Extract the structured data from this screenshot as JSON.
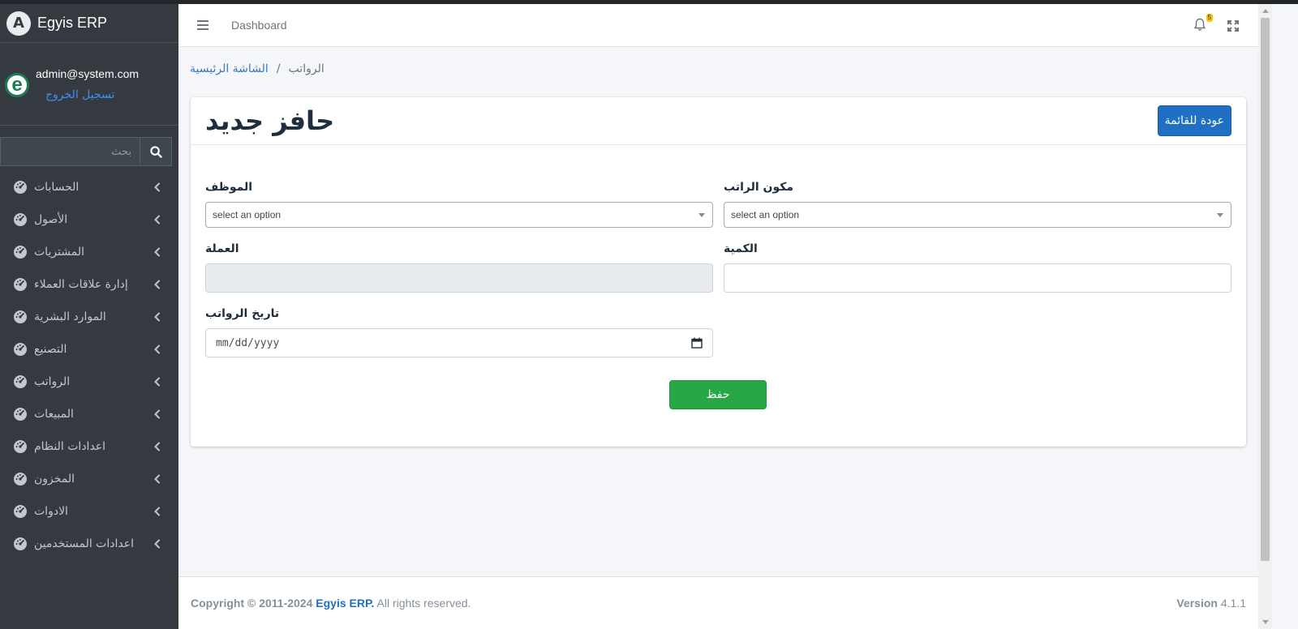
{
  "app": {
    "brand_name": "Egyis ERP",
    "brand_logo_letter": "A"
  },
  "user": {
    "avatar_letter": "e",
    "email": "admin@system.com",
    "logout_label": "تسجيل الخروج"
  },
  "search": {
    "placeholder": "بحث",
    "icon": "search-icon"
  },
  "sidebar": {
    "items": [
      {
        "label": "الحسابات"
      },
      {
        "label": "الأصول"
      },
      {
        "label": "المشتريات"
      },
      {
        "label": "إدارة علاقات العملاء"
      },
      {
        "label": "الموارد البشرية"
      },
      {
        "label": "التصنيع"
      },
      {
        "label": "الرواتب"
      },
      {
        "label": "المبيعات"
      },
      {
        "label": "اعدادات النظام"
      },
      {
        "label": "المخزون"
      },
      {
        "label": "الادوات"
      },
      {
        "label": "اعدادات المستخدمين"
      }
    ],
    "item_icon": "tachometer-icon"
  },
  "header": {
    "dashboard_link": "Dashboard",
    "notification_count": "5"
  },
  "breadcrumb": {
    "home": "الشاشة الرئيسية",
    "separator": "/",
    "current": "الرواتب"
  },
  "card": {
    "title": "حافز جديد",
    "back_button": "عودة للقائمة"
  },
  "form": {
    "employee": {
      "label": "الموظف",
      "value": "select an option"
    },
    "salary_component": {
      "label": "مكون الراتب",
      "value": "select an option"
    },
    "currency": {
      "label": "العملة",
      "value": ""
    },
    "quantity": {
      "label": "الكمية",
      "value": ""
    },
    "payroll_date": {
      "label": "تاريخ الرواتب",
      "placeholder": "mm/dd/yyyy"
    },
    "save_button": "حفظ"
  },
  "footer": {
    "copyright_prefix": "Copyright © 2011-2024",
    "brand": "Egyis ERP.",
    "rights": "All rights reserved.",
    "version_label": "Version",
    "version_value": "4.1.1"
  },
  "colors": {
    "sidebar_bg": "#343a40",
    "primary": "#1f6fc4",
    "success": "#28a745",
    "badge": "#ffc107"
  }
}
